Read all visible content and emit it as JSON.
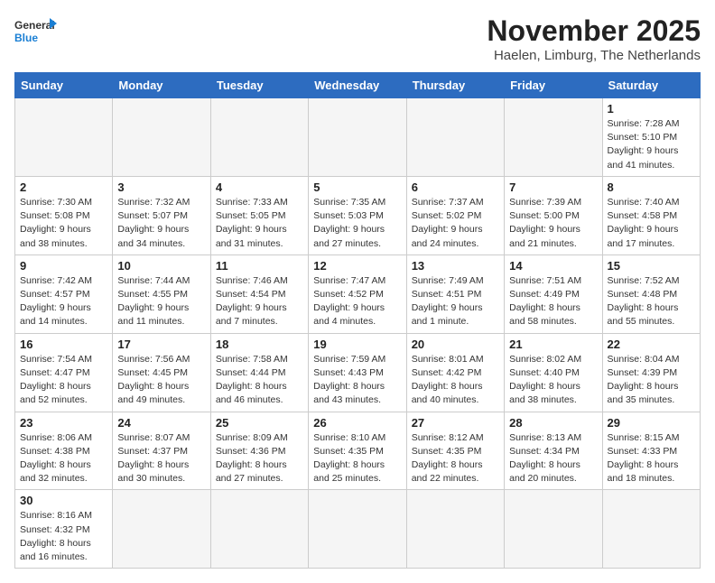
{
  "logo": {
    "line1": "General",
    "line2": "Blue"
  },
  "title": "November 2025",
  "subtitle": "Haelen, Limburg, The Netherlands",
  "days_of_week": [
    "Sunday",
    "Monday",
    "Tuesday",
    "Wednesday",
    "Thursday",
    "Friday",
    "Saturday"
  ],
  "weeks": [
    [
      {
        "day": "",
        "info": ""
      },
      {
        "day": "",
        "info": ""
      },
      {
        "day": "",
        "info": ""
      },
      {
        "day": "",
        "info": ""
      },
      {
        "day": "",
        "info": ""
      },
      {
        "day": "",
        "info": ""
      },
      {
        "day": "1",
        "info": "Sunrise: 7:28 AM\nSunset: 5:10 PM\nDaylight: 9 hours and 41 minutes."
      }
    ],
    [
      {
        "day": "2",
        "info": "Sunrise: 7:30 AM\nSunset: 5:08 PM\nDaylight: 9 hours and 38 minutes."
      },
      {
        "day": "3",
        "info": "Sunrise: 7:32 AM\nSunset: 5:07 PM\nDaylight: 9 hours and 34 minutes."
      },
      {
        "day": "4",
        "info": "Sunrise: 7:33 AM\nSunset: 5:05 PM\nDaylight: 9 hours and 31 minutes."
      },
      {
        "day": "5",
        "info": "Sunrise: 7:35 AM\nSunset: 5:03 PM\nDaylight: 9 hours and 27 minutes."
      },
      {
        "day": "6",
        "info": "Sunrise: 7:37 AM\nSunset: 5:02 PM\nDaylight: 9 hours and 24 minutes."
      },
      {
        "day": "7",
        "info": "Sunrise: 7:39 AM\nSunset: 5:00 PM\nDaylight: 9 hours and 21 minutes."
      },
      {
        "day": "8",
        "info": "Sunrise: 7:40 AM\nSunset: 4:58 PM\nDaylight: 9 hours and 17 minutes."
      }
    ],
    [
      {
        "day": "9",
        "info": "Sunrise: 7:42 AM\nSunset: 4:57 PM\nDaylight: 9 hours and 14 minutes."
      },
      {
        "day": "10",
        "info": "Sunrise: 7:44 AM\nSunset: 4:55 PM\nDaylight: 9 hours and 11 minutes."
      },
      {
        "day": "11",
        "info": "Sunrise: 7:46 AM\nSunset: 4:54 PM\nDaylight: 9 hours and 7 minutes."
      },
      {
        "day": "12",
        "info": "Sunrise: 7:47 AM\nSunset: 4:52 PM\nDaylight: 9 hours and 4 minutes."
      },
      {
        "day": "13",
        "info": "Sunrise: 7:49 AM\nSunset: 4:51 PM\nDaylight: 9 hours and 1 minute."
      },
      {
        "day": "14",
        "info": "Sunrise: 7:51 AM\nSunset: 4:49 PM\nDaylight: 8 hours and 58 minutes."
      },
      {
        "day": "15",
        "info": "Sunrise: 7:52 AM\nSunset: 4:48 PM\nDaylight: 8 hours and 55 minutes."
      }
    ],
    [
      {
        "day": "16",
        "info": "Sunrise: 7:54 AM\nSunset: 4:47 PM\nDaylight: 8 hours and 52 minutes."
      },
      {
        "day": "17",
        "info": "Sunrise: 7:56 AM\nSunset: 4:45 PM\nDaylight: 8 hours and 49 minutes."
      },
      {
        "day": "18",
        "info": "Sunrise: 7:58 AM\nSunset: 4:44 PM\nDaylight: 8 hours and 46 minutes."
      },
      {
        "day": "19",
        "info": "Sunrise: 7:59 AM\nSunset: 4:43 PM\nDaylight: 8 hours and 43 minutes."
      },
      {
        "day": "20",
        "info": "Sunrise: 8:01 AM\nSunset: 4:42 PM\nDaylight: 8 hours and 40 minutes."
      },
      {
        "day": "21",
        "info": "Sunrise: 8:02 AM\nSunset: 4:40 PM\nDaylight: 8 hours and 38 minutes."
      },
      {
        "day": "22",
        "info": "Sunrise: 8:04 AM\nSunset: 4:39 PM\nDaylight: 8 hours and 35 minutes."
      }
    ],
    [
      {
        "day": "23",
        "info": "Sunrise: 8:06 AM\nSunset: 4:38 PM\nDaylight: 8 hours and 32 minutes."
      },
      {
        "day": "24",
        "info": "Sunrise: 8:07 AM\nSunset: 4:37 PM\nDaylight: 8 hours and 30 minutes."
      },
      {
        "day": "25",
        "info": "Sunrise: 8:09 AM\nSunset: 4:36 PM\nDaylight: 8 hours and 27 minutes."
      },
      {
        "day": "26",
        "info": "Sunrise: 8:10 AM\nSunset: 4:35 PM\nDaylight: 8 hours and 25 minutes."
      },
      {
        "day": "27",
        "info": "Sunrise: 8:12 AM\nSunset: 4:35 PM\nDaylight: 8 hours and 22 minutes."
      },
      {
        "day": "28",
        "info": "Sunrise: 8:13 AM\nSunset: 4:34 PM\nDaylight: 8 hours and 20 minutes."
      },
      {
        "day": "29",
        "info": "Sunrise: 8:15 AM\nSunset: 4:33 PM\nDaylight: 8 hours and 18 minutes."
      }
    ],
    [
      {
        "day": "30",
        "info": "Sunrise: 8:16 AM\nSunset: 4:32 PM\nDaylight: 8 hours and 16 minutes."
      },
      {
        "day": "",
        "info": ""
      },
      {
        "day": "",
        "info": ""
      },
      {
        "day": "",
        "info": ""
      },
      {
        "day": "",
        "info": ""
      },
      {
        "day": "",
        "info": ""
      },
      {
        "day": "",
        "info": ""
      }
    ]
  ]
}
